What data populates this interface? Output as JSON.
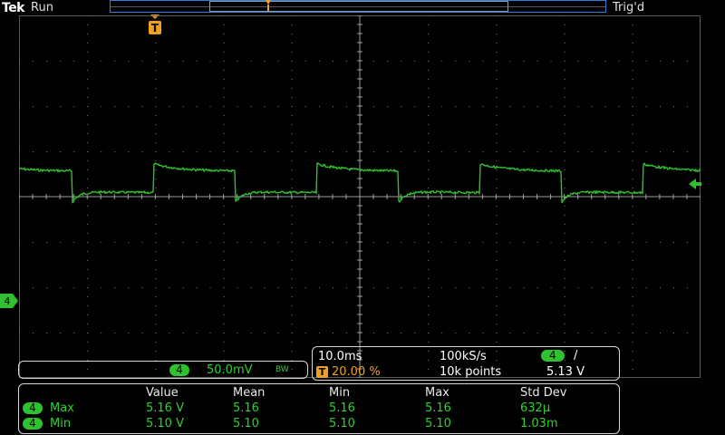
{
  "header": {
    "brand": "Tek",
    "run_state": "Run",
    "trigger_status": "Trig'd",
    "trigger_marker": "T"
  },
  "channel": {
    "number": "4",
    "scale": "50.0mV",
    "bw_limit": "BW",
    "ground_marker": "4",
    "color": "#2fc12f"
  },
  "horizontal": {
    "time_per_div": "10.0ms",
    "sample_rate": "100kS/s",
    "trigger_badge": "T",
    "trigger_position": "20.00 %",
    "record_length": "10k points",
    "trigger_source": "4",
    "trigger_slope": "/",
    "trigger_level": "5.13 V"
  },
  "measurements": {
    "headers": [
      "Value",
      "Mean",
      "Min",
      "Max",
      "Std Dev"
    ],
    "rows": [
      {
        "channel": "4",
        "name": "Max",
        "value": "5.16 V",
        "mean": "5.16",
        "min": "5.16",
        "max": "5.16",
        "std_dev": "632μ"
      },
      {
        "channel": "4",
        "name": "Min",
        "value": "5.10 V",
        "mean": "5.10",
        "min": "5.10",
        "max": "5.10",
        "std_dev": "1.03m"
      }
    ]
  },
  "colors": {
    "trace": "#2fc12f",
    "trigger": "#f0a020",
    "record_bar": "#2d7fd6"
  }
}
